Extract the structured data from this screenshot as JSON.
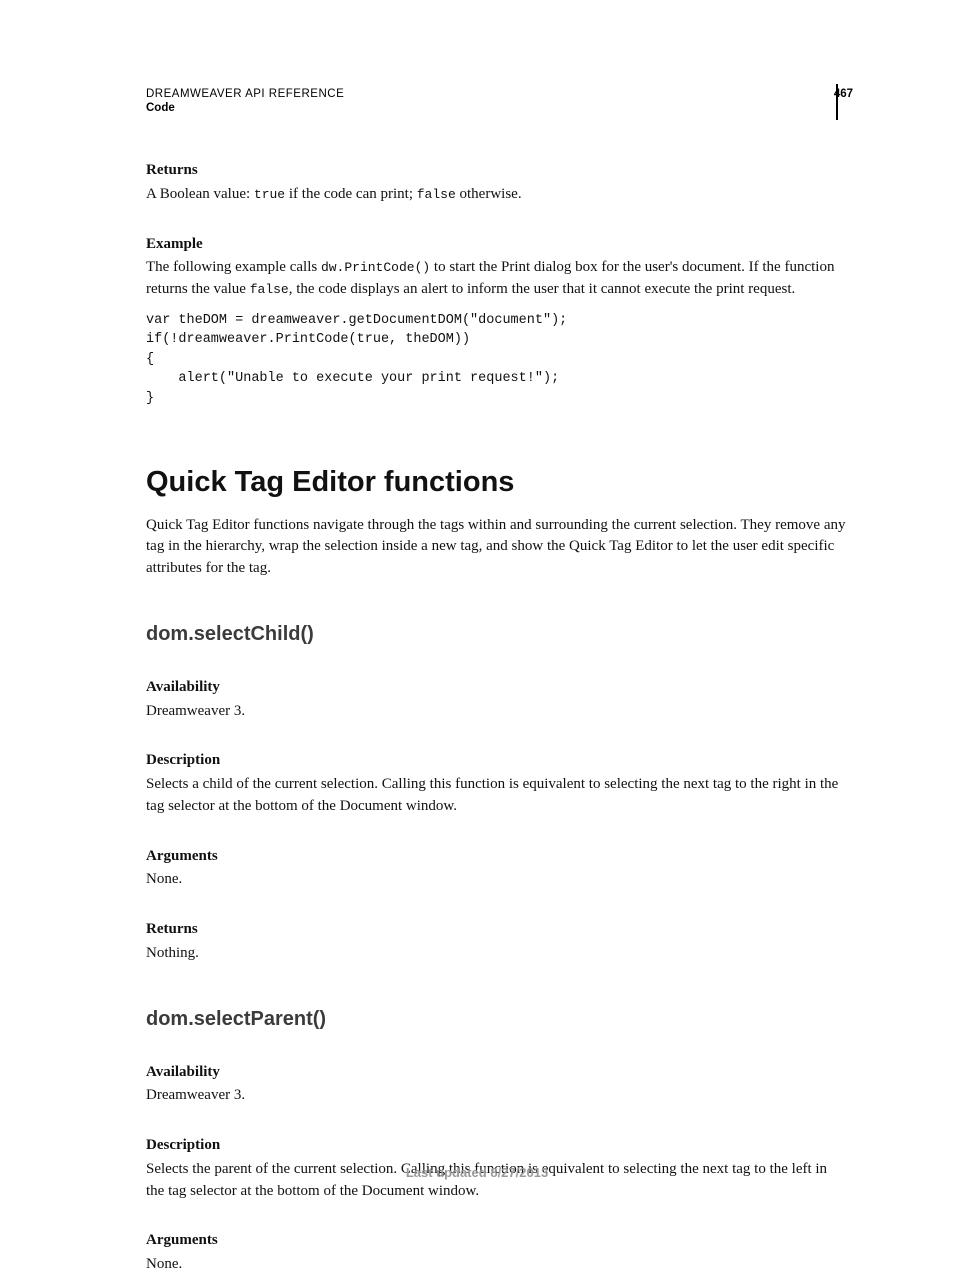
{
  "header": {
    "title": "DREAMWEAVER API REFERENCE",
    "subtitle": "Code",
    "page_number": "467"
  },
  "continued": {
    "returns_label": "Returns",
    "returns_text_pre": "A Boolean value: ",
    "returns_true": "true",
    "returns_text_mid": " if the code can print; ",
    "returns_false": "false",
    "returns_text_post": " otherwise.",
    "example_label": "Example",
    "example_text_pre": "The following example calls ",
    "example_call": "dw.PrintCode()",
    "example_text_mid": " to start the Print dialog box for the user's document. If the function returns the value ",
    "example_val": "false",
    "example_text_post": ", the code displays an alert to inform the user that it cannot execute the print request.",
    "codeblock": "var theDOM = dreamweaver.getDocumentDOM(\"document\");\nif(!dreamweaver.PrintCode(true, theDOM))\n{\n    alert(\"Unable to execute your print request!\");\n}"
  },
  "section": {
    "title": "Quick Tag Editor functions",
    "intro": "Quick Tag Editor functions navigate through the tags within and surrounding the current selection. They remove any tag in the hierarchy, wrap the selection inside a new tag, and show the Quick Tag Editor to let the user edit specific attributes for the tag."
  },
  "fn1": {
    "name": "dom.selectChild()",
    "availability_label": "Availability",
    "availability_text": "Dreamweaver 3.",
    "description_label": "Description",
    "description_text": "Selects a child of the current selection. Calling this function is equivalent to selecting the next tag to the right in the tag selector at the bottom of the Document window.",
    "arguments_label": "Arguments",
    "arguments_text": "None.",
    "returns_label": "Returns",
    "returns_text": "Nothing."
  },
  "fn2": {
    "name": "dom.selectParent()",
    "availability_label": "Availability",
    "availability_text": "Dreamweaver 3.",
    "description_label": "Description",
    "description_text": "Selects the parent of the current selection. Calling this function is equivalent to selecting the next tag to the left in the tag selector at the bottom of the Document window.",
    "arguments_label": "Arguments",
    "arguments_text": "None."
  },
  "footer": {
    "text": "Last updated 8/27/2013"
  }
}
